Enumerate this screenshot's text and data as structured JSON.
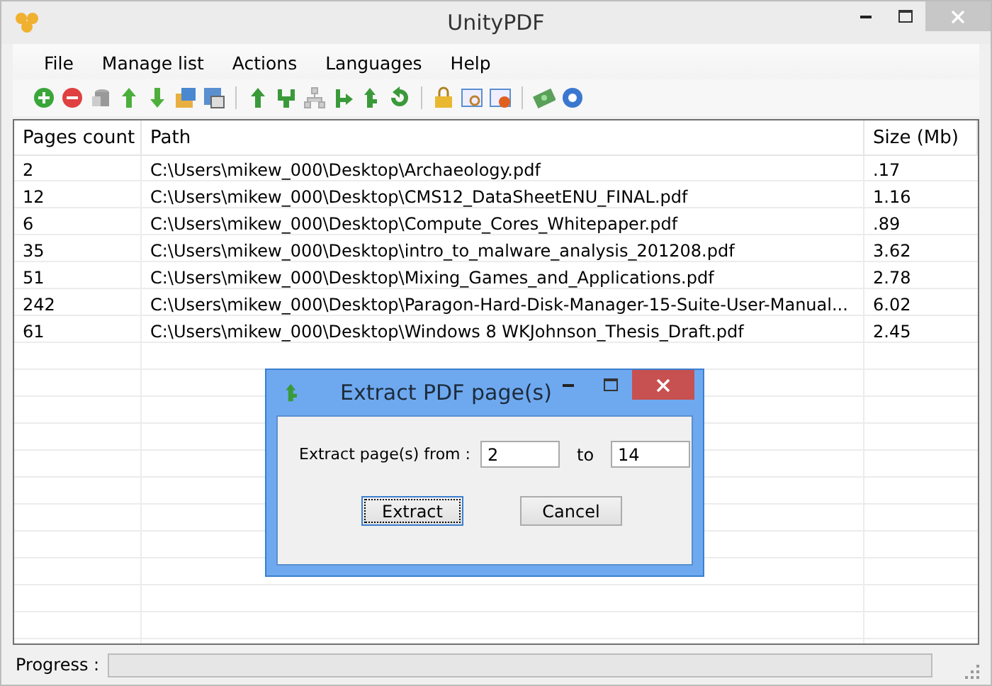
{
  "window": {
    "title": "UnityPDF"
  },
  "menu": [
    "File",
    "Manage list",
    "Actions",
    "Languages",
    "Help"
  ],
  "table": {
    "columns": [
      "Pages count",
      "Path",
      "Size (Mb)"
    ],
    "rows": [
      [
        "2",
        "C:\\Users\\mikew_000\\Desktop\\Archaeology.pdf",
        ".17"
      ],
      [
        "12",
        "C:\\Users\\mikew_000\\Desktop\\CMS12_DataSheetENU_FINAL.pdf",
        "1.16"
      ],
      [
        "6",
        "C:\\Users\\mikew_000\\Desktop\\Compute_Cores_Whitepaper.pdf",
        ".89"
      ],
      [
        "35",
        "C:\\Users\\mikew_000\\Desktop\\intro_to_malware_analysis_201208.pdf",
        "3.62"
      ],
      [
        "51",
        "C:\\Users\\mikew_000\\Desktop\\Mixing_Games_and_Applications.pdf",
        "2.78"
      ],
      [
        "242",
        "C:\\Users\\mikew_000\\Desktop\\Paragon-Hard-Disk-Manager-15-Suite-User-Manual...",
        "6.02"
      ],
      [
        "61",
        "C:\\Users\\mikew_000\\Desktop\\Windows 8 WKJohnson_Thesis_Draft.pdf",
        "2.45"
      ]
    ]
  },
  "status_bar": {
    "label": "Progress :",
    "progress": {
      "level": 0
    }
  },
  "dialog": {
    "title": "Extract PDF page(s)",
    "from_label": "Extract page(s) from :",
    "from_value": "2",
    "to_label": "to",
    "to_value": "14",
    "buttons": [
      {
        "label": "Extract",
        "focused": true
      },
      {
        "label": "Cancel",
        "focused": false
      }
    ]
  }
}
